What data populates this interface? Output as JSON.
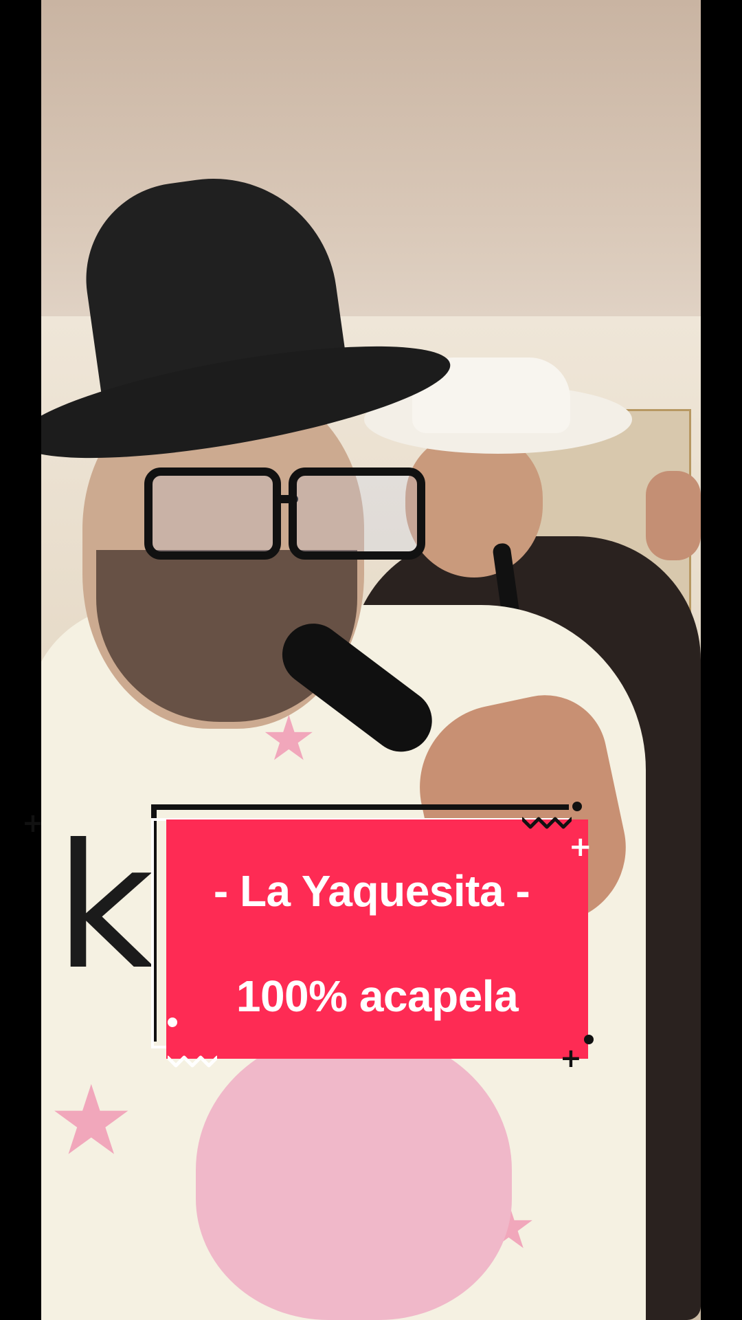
{
  "caption": {
    "line1": "- La Yaquesita -",
    "line2": "100% acapela"
  },
  "colors": {
    "caption_background": "#fe2b54",
    "caption_text": "#ffffff",
    "letterbox": "#000000"
  }
}
